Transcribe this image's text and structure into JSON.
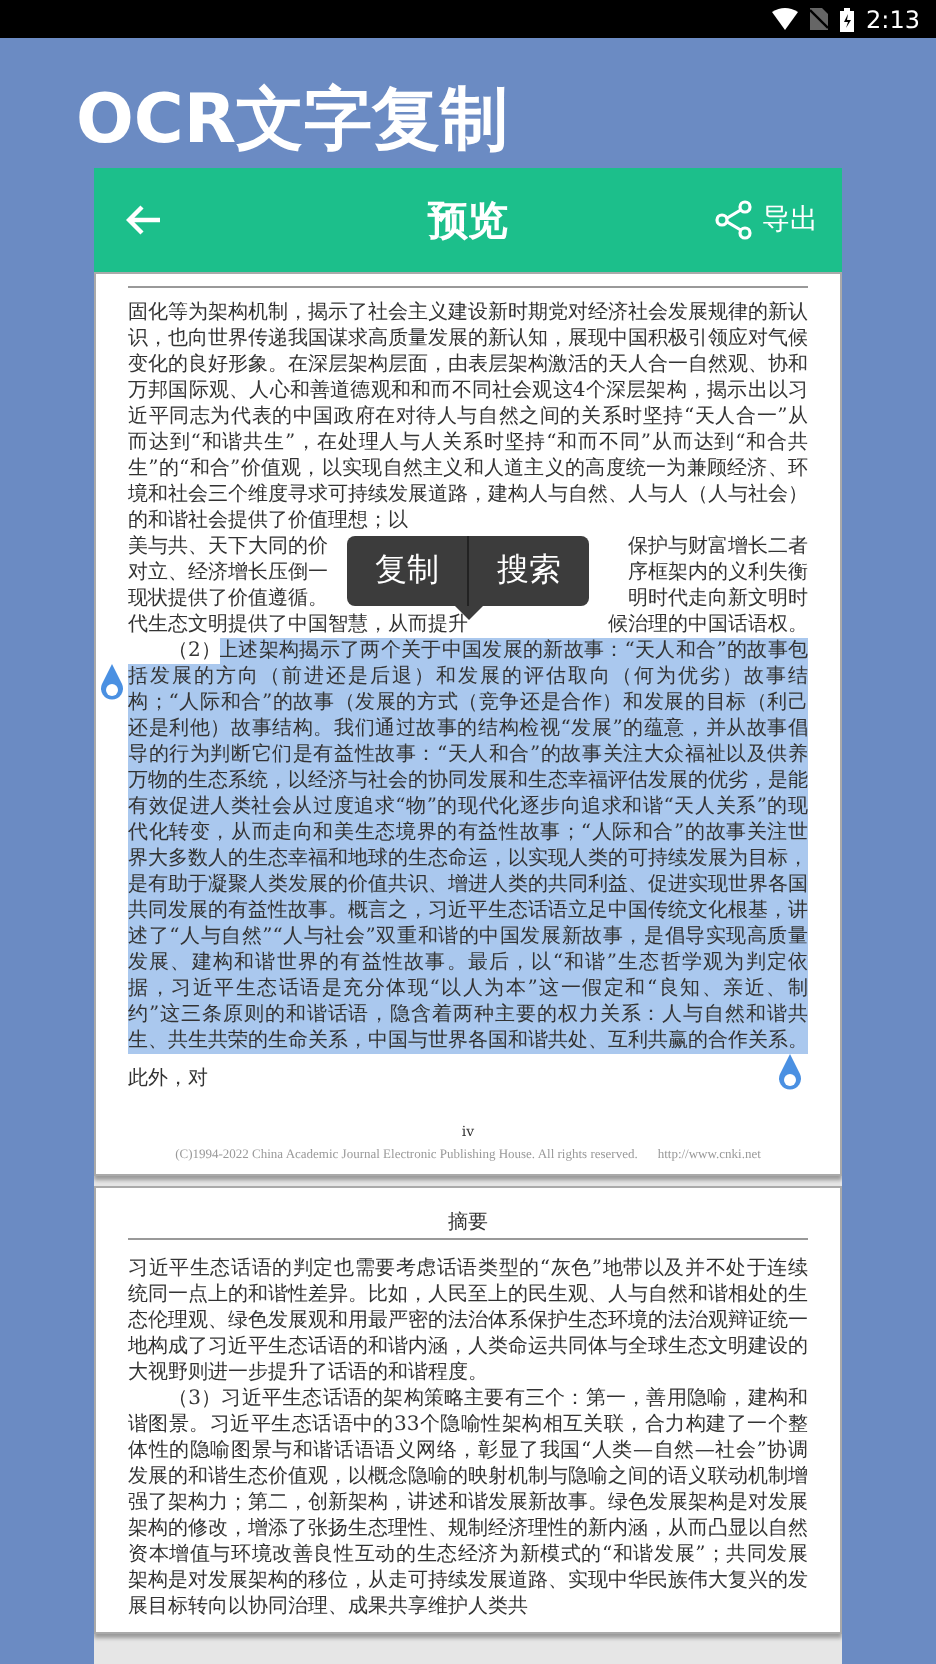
{
  "status_bar": {
    "time": "2:13"
  },
  "app_title": "OCR文字复制",
  "toolbar": {
    "title": "预览",
    "export_label": "导出"
  },
  "popup": {
    "actions": [
      "复制",
      "搜索"
    ]
  },
  "pages": [
    {
      "paragraphs": [
        {
          "kind": "covered",
          "text": "固化等为架构机制，揭示了社会主义建设新时期党对经济社会发展规律的新认识，也向世界传递我国谋求高质量发展的新认知，展现中国积极引领应对气候变化的良好形象。在深层架构层面，由表层架构激活的天人合一自然观、协和万邦国际观、人心和善道德观和和而不同社会观这4个深层架构，揭示出以习近平同志为代表的中国政府在对待人与自然之间的关系时坚持“天人合一”从而达到“和谐共生”，在处理人与人关系时坚持“和而不同”从而达到“和合共生”的“和合”价值观，以实现自然主义和人道主义的高度统一为兼顾经济、环境和社会三个维度寻求可持续发展道路，建构人与自然、人与人（人与社会）的和谐社会提供了价值理想；以",
          "rows": [
            {
              "left": "美与共、天下大同的价",
              "right": "保护与财富增长二者"
            },
            {
              "left": "对立、经济增长压倒一",
              "right": "序框架内的义利失衡"
            },
            {
              "left": "现状提供了价值遵循。",
              "right": "明时代走向新文明时"
            },
            {
              "left": "代生态文明提供了中国智慧，从而提升",
              "right": "候治理的中国话语权。"
            }
          ]
        },
        {
          "kind": "selection",
          "lead": "（2）",
          "selected": "上述架构揭示了两个关于中国发展的新故事：“天人和合”的故事包括发展的方向（前进还是后退）和发展的评估取向（何为优劣）故事结构；“人际和合”的故事（发展的方式（竞争还是合作）和发展的目标（利己还是利他）故事结构。我们通过故事的结构检视“发展”的蕴意，并从故事倡导的行为判断它们是有益性故事：“天人和合”的故事关注大众福祉以及供养万物的生态系统，以经济与社会的协同发展和生态幸福评估发展的优劣，是能有效促进人类社会从过度追求“物”的现代化逐步向追求和谐“天人关系”的现代化转变，从而走向和美生态境界的有益性故事；“人际和合”的故事关注世界大多数人的生态幸福和地球的生态命运，以实现人类的可持续发展为目标，是有助于凝聚人类发展的价值共识、增进人类的共同利益、促进实现世界各国共同发展的有益性故事。概言之，习近平生态话语立足中国传统文化根基，讲述了“人与自然”“人与社会”双重和谐的中国发展新故事，是倡导实现高质量发展、建构和谐世界的有益性故事。最后，以“和谐”生态哲学观为判定依据，习近平生态话语是充分体现“以人为本”这一假定和“良知、亲近、制约”这三条原则的和谐话语，隐含着两种主要的权力关系：人与自然和谐共生、共生共荣的生命关系，中国与世界各国和谐共处、互利共赢的合作关系。",
          "rest": "此外，对"
        }
      ],
      "page_number": "iv",
      "copyright": "(C)1994-2022 China Academic Journal Electronic Publishing House. All rights reserved.",
      "url": "http://www.cnki.net"
    },
    {
      "header": "摘要",
      "paragraphs": [
        {
          "kind": "continued",
          "text": "习近平生态话语的判定也需要考虑话语类型的“灰色”地带以及并不处于连续统同一点上的和谐性差异。比如，人民至上的民生观、人与自然和谐相处的生态伦理观、绿色发展观和用最严密的法治体系保护生态环境的法治观辩证统一地构成了习近平生态话语的和谐内涵，人类命运共同体与全球生态文明建设的大视野则进一步提升了话语的和谐程度。"
        },
        {
          "kind": "indented",
          "text": "（3）习近平生态话语的架构策略主要有三个：第一，善用隐喻，建构和谐图景。习近平生态话语中的33个隐喻性架构相互关联，合力构建了一个整体性的隐喻图景与和谐话语语义网络，彰显了我国“人类—自然—社会”协调发展的和谐生态价值观，以概念隐喻的映射机制与隐喻之间的语义联动机制增强了架构力；第二，创新架构，讲述和谐发展新故事。绿色发展架构是对发展架构的修改，增添了张扬生态理性、规制经济理性的新内涵，从而凸显以自然资本增值与环境改善良性互动的生态经济为新模式的“和谐发展”；共同发展架构是对发展架构的移位，从走可持续发展道路、实现中华民族伟大复兴的发展目标转向以协同治理、成果共享维护人类共"
        }
      ]
    }
  ]
}
